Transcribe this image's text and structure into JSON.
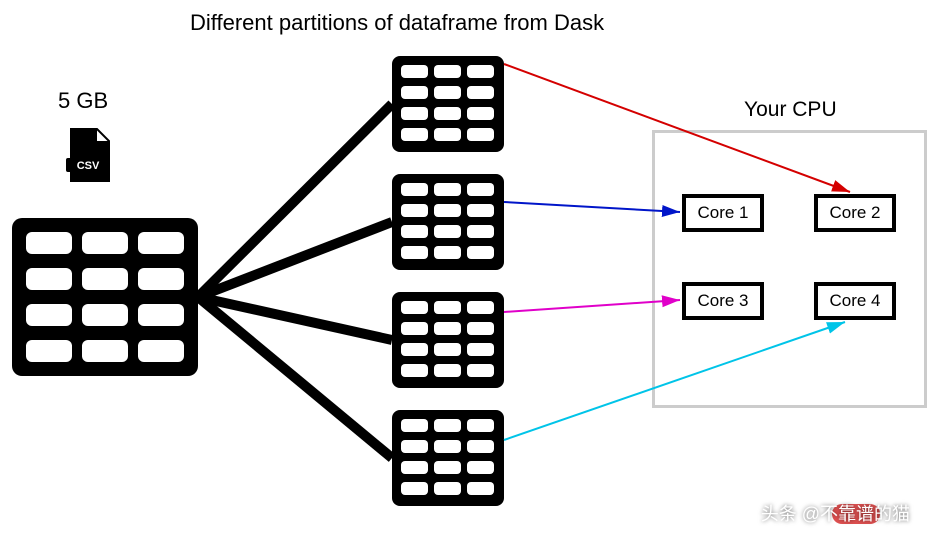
{
  "title": "Different partitions of dataframe from Dask",
  "file": {
    "size_label": "5 GB",
    "type_badge": "CSV"
  },
  "cpu": {
    "label": "Your CPU",
    "cores": [
      "Core 1",
      "Core 2",
      "Core 3",
      "Core 4"
    ]
  },
  "arrows": [
    {
      "from_partition": 1,
      "to_core": "Core 2",
      "color": "#d40000"
    },
    {
      "from_partition": 2,
      "to_core": "Core 1",
      "color": "#0015c9"
    },
    {
      "from_partition": 3,
      "to_core": "Core 3",
      "color": "#e000c9"
    },
    {
      "from_partition": 4,
      "to_core": "Core 4",
      "color": "#00c4e8"
    }
  ],
  "watermark": "头条 @不靠谱的猫"
}
